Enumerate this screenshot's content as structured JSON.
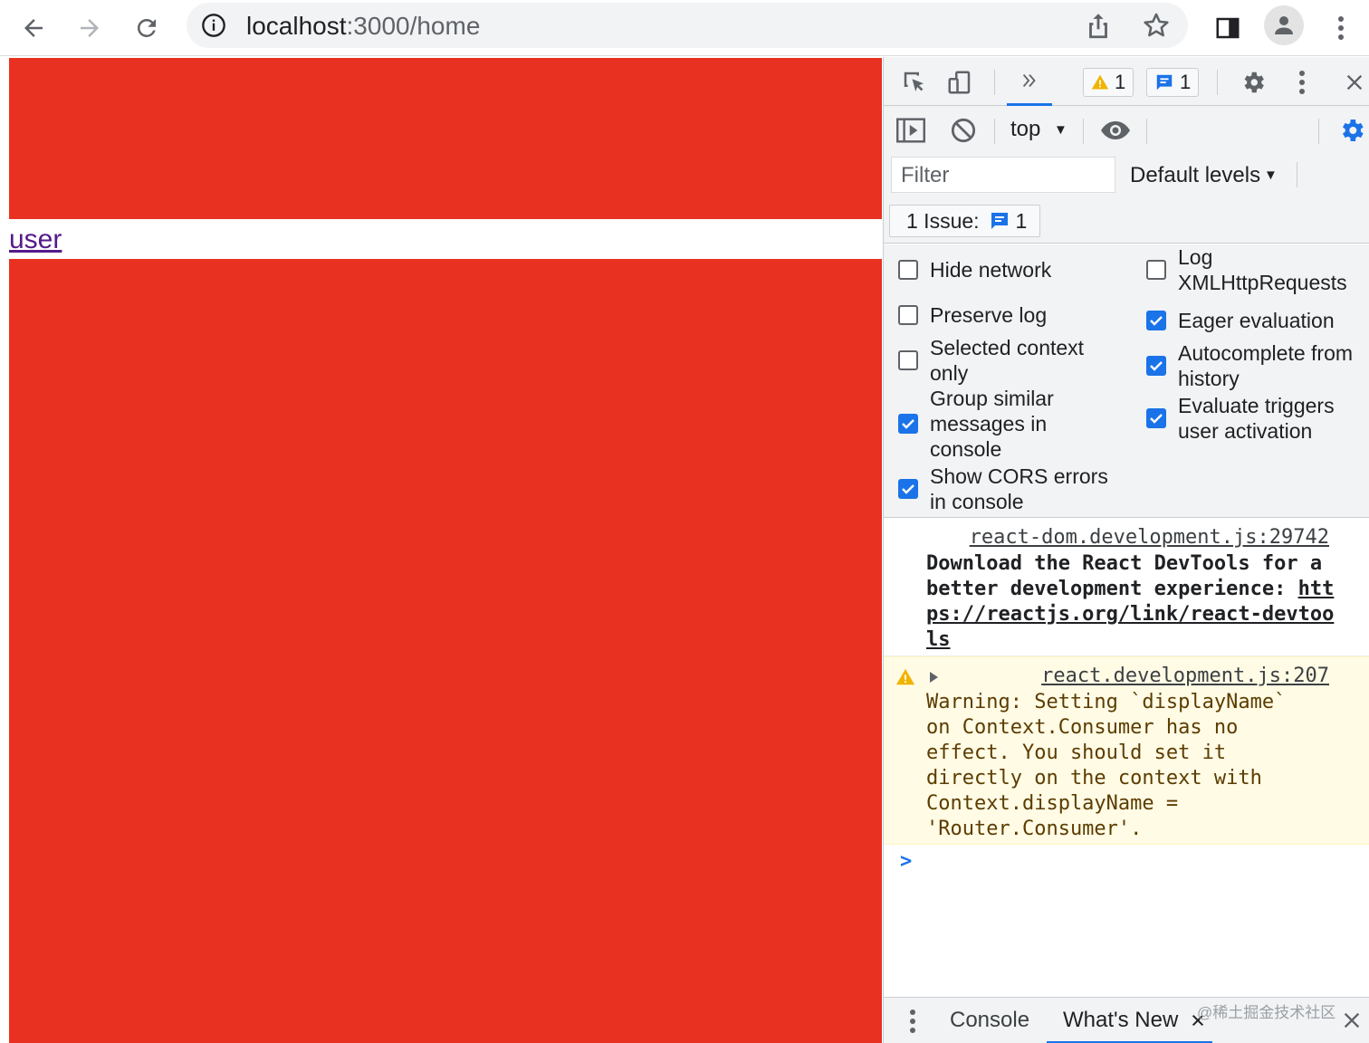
{
  "browser": {
    "url_host": "localhost",
    "url_path": ":3000/home"
  },
  "page": {
    "link_text": "user",
    "colors": {
      "block": "#e93122",
      "link": "#551a8b"
    }
  },
  "devtools": {
    "toolbar": {
      "warning_count": "1",
      "message_count": "1"
    },
    "context": {
      "value": "top",
      "caret": "▼"
    },
    "filter": {
      "placeholder": "Filter"
    },
    "levels": {
      "label": "Default levels",
      "caret": "▼"
    },
    "issues": {
      "label": "1 Issue:",
      "count": "1"
    },
    "settings": {
      "hide_network": {
        "label": "Hide network",
        "checked": false
      },
      "log_xhr": {
        "label": "Log XMLHttpRequests",
        "checked": false
      },
      "preserve_log": {
        "label": "Preserve log",
        "checked": false
      },
      "eager_eval": {
        "label": "Eager evaluation",
        "checked": true
      },
      "selected_context": {
        "label": "Selected context only",
        "checked": false
      },
      "autocomplete": {
        "label": "Autocomplete from history",
        "checked": true
      },
      "group_similar": {
        "label": "Group similar messages in console",
        "checked": true
      },
      "eval_triggers": {
        "label": "Evaluate triggers user activation",
        "checked": true
      },
      "show_cors": {
        "label": "Show CORS errors in console",
        "checked": true
      }
    },
    "console": {
      "msg1": {
        "source": "react-dom.development.js:29742",
        "text": "Download the React DevTools for a better development experience: ",
        "link": "https://reactjs.org/link/react-devtools"
      },
      "msg2": {
        "source": "react.development.js:207",
        "text": "Warning: Setting `displayName`\non Context.Consumer has no\neffect. You should set it\ndirectly on the context with\nContext.displayName =\n'Router.Consumer'."
      },
      "prompt": ">"
    },
    "drawer": {
      "tab_console": "Console",
      "tab_whats_new": "What's New",
      "watermark": "@稀土掘金技术社区"
    }
  }
}
